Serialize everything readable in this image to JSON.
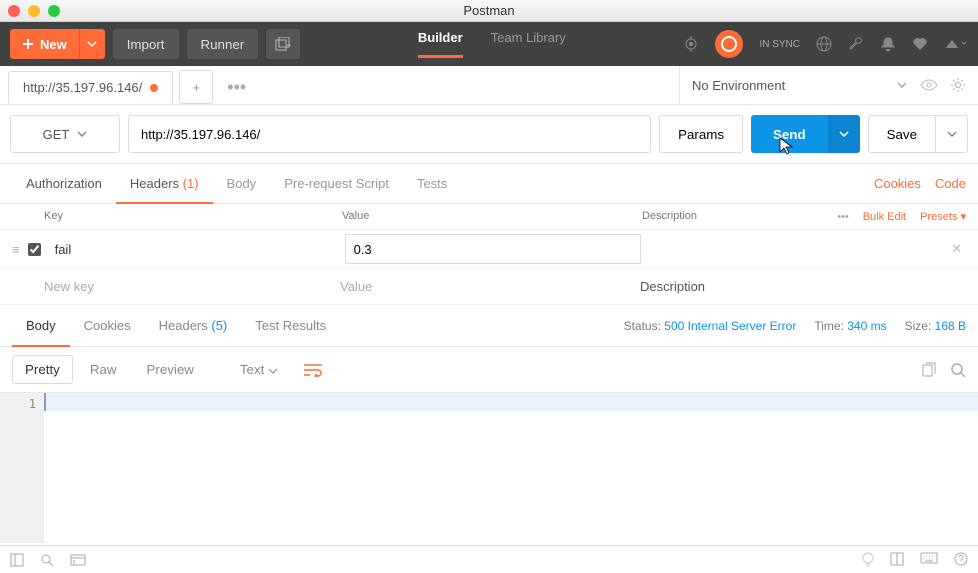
{
  "window": {
    "title": "Postman"
  },
  "toolbar": {
    "new_label": "New",
    "import_label": "Import",
    "runner_label": "Runner",
    "nav": {
      "builder": "Builder",
      "team_library": "Team Library"
    },
    "sync_label": "IN SYNC"
  },
  "tabs": {
    "active_tab_label": "http://35.197.96.146/",
    "env_label": "No Environment"
  },
  "request": {
    "method": "GET",
    "url": "http://35.197.96.146/",
    "params_label": "Params",
    "send_label": "Send",
    "save_label": "Save"
  },
  "req_tabs": {
    "authorization": "Authorization",
    "headers": "Headers",
    "headers_count": "(1)",
    "body": "Body",
    "prerequest": "Pre-request Script",
    "tests": "Tests",
    "cookies": "Cookies",
    "code": "Code"
  },
  "headers_table": {
    "col_key": "Key",
    "col_value": "Value",
    "col_desc": "Description",
    "bulk_edit": "Bulk Edit",
    "presets": "Presets",
    "rows": [
      {
        "key": "fail",
        "value": "0.3",
        "description": ""
      }
    ],
    "placeholder_key": "New key",
    "placeholder_value": "Value",
    "placeholder_desc": "Description"
  },
  "response": {
    "tabs": {
      "body": "Body",
      "cookies": "Cookies",
      "headers": "Headers",
      "headers_count": "(5)",
      "test_results": "Test Results"
    },
    "status_label": "Status:",
    "status_value": "500 Internal Server Error",
    "time_label": "Time:",
    "time_value": "340 ms",
    "size_label": "Size:",
    "size_value": "168 B",
    "view": {
      "pretty": "Pretty",
      "raw": "Raw",
      "preview": "Preview",
      "format": "Text"
    },
    "editor_line_number": "1"
  }
}
